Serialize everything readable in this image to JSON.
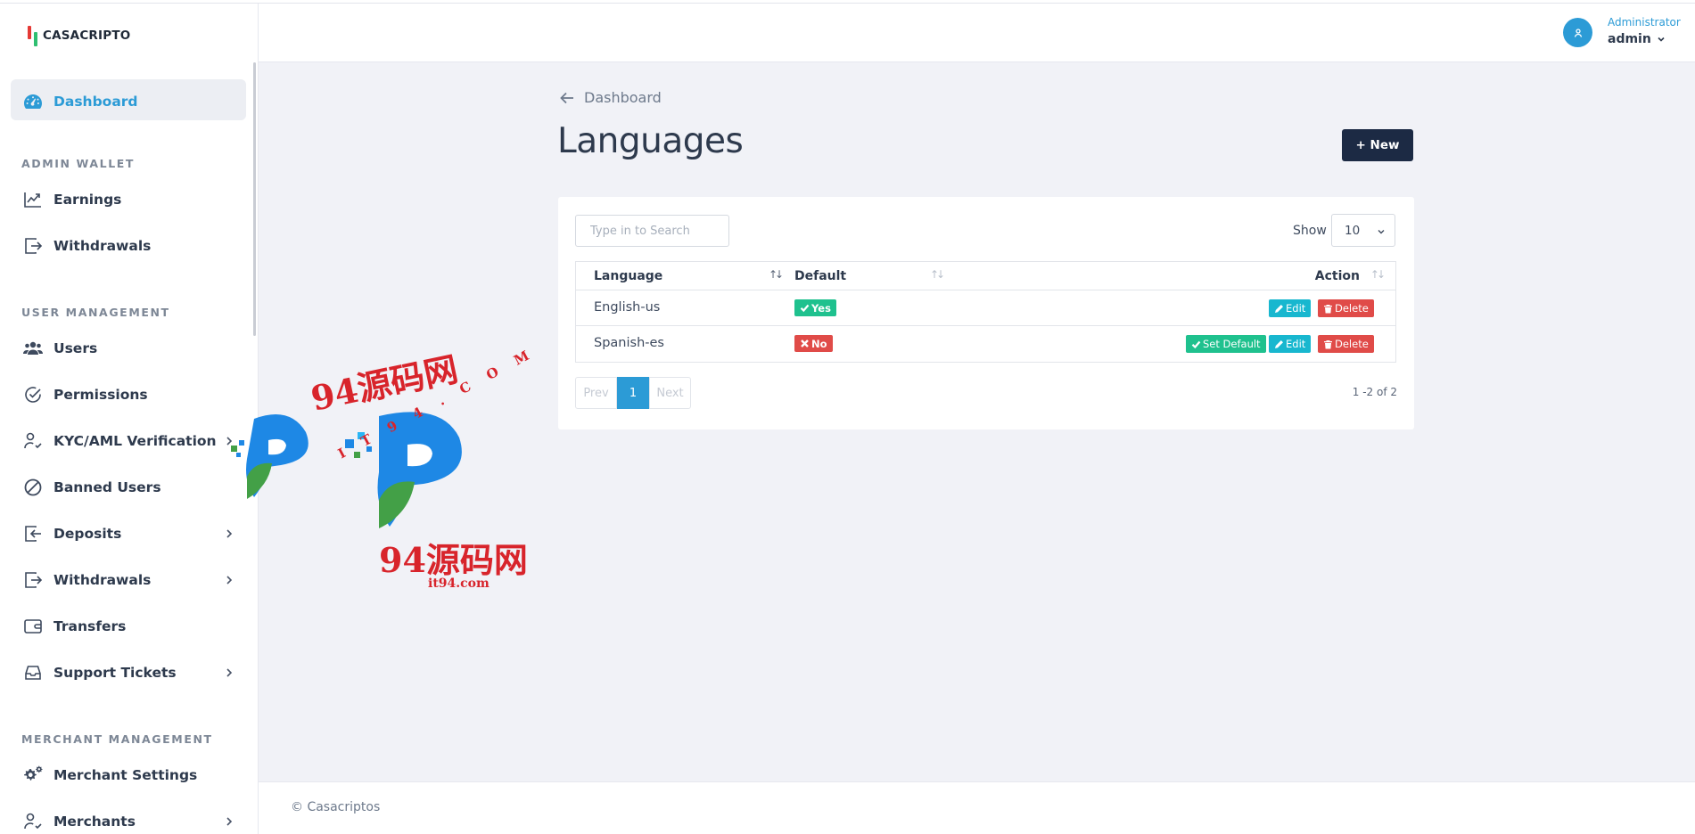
{
  "brand": {
    "name": "CASACRIPTO"
  },
  "sidebar": {
    "dashboard": "Dashboard",
    "sections": {
      "admin_wallet": "ADMIN WALLET",
      "user_management": "USER MANAGEMENT",
      "merchant_management": "MERCHANT MANAGEMENT"
    },
    "items": {
      "earnings": "Earnings",
      "withdrawals_wallet": "Withdrawals",
      "users": "Users",
      "permissions": "Permissions",
      "kyc": "KYC/AML Verification",
      "banned": "Banned Users",
      "deposits": "Deposits",
      "withdrawals": "Withdrawals",
      "transfers": "Transfers",
      "support": "Support Tickets",
      "merchant_settings": "Merchant Settings",
      "merchants": "Merchants"
    }
  },
  "header": {
    "role": "Administrator",
    "username": "admin"
  },
  "page": {
    "back_label": "Dashboard",
    "title": "Languages",
    "new_button": "+ New"
  },
  "table_controls": {
    "search_placeholder": "Type in to Search",
    "show_label": "Show",
    "page_size": "10"
  },
  "table": {
    "columns": {
      "language": "Language",
      "default": "Default",
      "action": "Action"
    },
    "rows": [
      {
        "language": "English-us",
        "default": "Yes",
        "set_default": "",
        "edit": "Edit",
        "delete": "Delete"
      },
      {
        "language": "Spanish-es",
        "default": "No",
        "set_default": "Set Default",
        "edit": "Edit",
        "delete": "Delete"
      }
    ]
  },
  "pagination": {
    "prev": "Prev",
    "current": "1",
    "next": "Next",
    "range": "1 -2 of 2"
  },
  "footer": {
    "text": "© Casacriptos"
  },
  "watermark": {
    "text_top": "94源码网",
    "text_arc": "IT94.COM",
    "text_bottom": "94源码网",
    "text_url": "it94.com"
  },
  "colors": {
    "accent": "#2c9bd6",
    "dark_button": "#1c2a44",
    "success": "#1fc18e",
    "danger": "#e04b48",
    "info": "#18b7cf"
  }
}
